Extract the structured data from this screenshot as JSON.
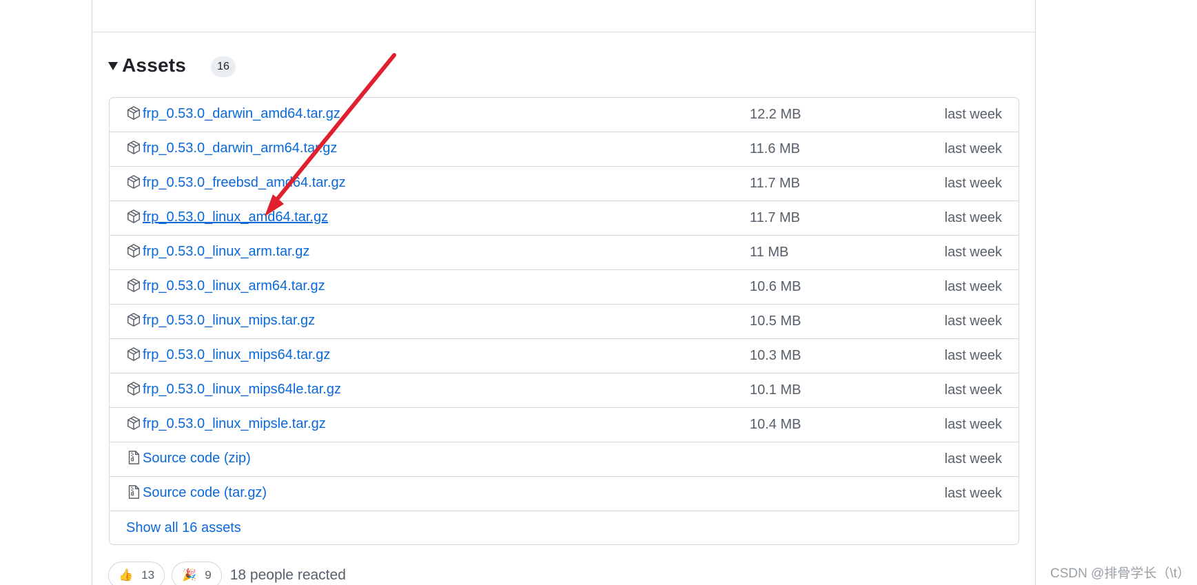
{
  "assets": {
    "title": "Assets",
    "count": "16",
    "items": [
      {
        "name": "frp_0.53.0_darwin_amd64.tar.gz",
        "size": "12.2 MB",
        "date": "last week",
        "icon": "package-icon"
      },
      {
        "name": "frp_0.53.0_darwin_arm64.tar.gz",
        "size": "11.6 MB",
        "date": "last week",
        "icon": "package-icon"
      },
      {
        "name": "frp_0.53.0_freebsd_amd64.tar.gz",
        "size": "11.7 MB",
        "date": "last week",
        "icon": "package-icon"
      },
      {
        "name": "frp_0.53.0_linux_amd64.tar.gz",
        "size": "11.7 MB",
        "date": "last week",
        "icon": "package-icon"
      },
      {
        "name": "frp_0.53.0_linux_arm.tar.gz",
        "size": "11 MB",
        "date": "last week",
        "icon": "package-icon"
      },
      {
        "name": "frp_0.53.0_linux_arm64.tar.gz",
        "size": "10.6 MB",
        "date": "last week",
        "icon": "package-icon"
      },
      {
        "name": "frp_0.53.0_linux_mips.tar.gz",
        "size": "10.5 MB",
        "date": "last week",
        "icon": "package-icon"
      },
      {
        "name": "frp_0.53.0_linux_mips64.tar.gz",
        "size": "10.3 MB",
        "date": "last week",
        "icon": "package-icon"
      },
      {
        "name": "frp_0.53.0_linux_mips64le.tar.gz",
        "size": "10.1 MB",
        "date": "last week",
        "icon": "package-icon"
      },
      {
        "name": "frp_0.53.0_linux_mipsle.tar.gz",
        "size": "10.4 MB",
        "date": "last week",
        "icon": "package-icon"
      }
    ],
    "source": [
      {
        "name": "Source code",
        "format": "(zip)",
        "date": "last week",
        "icon": "file-zip-icon"
      },
      {
        "name": "Source code",
        "format": "(tar.gz)",
        "date": "last week",
        "icon": "file-zip-icon"
      }
    ],
    "show_all": "Show all 16 assets"
  },
  "reactions": {
    "thumbs_up": {
      "emoji": "👍",
      "count": "13"
    },
    "hooray": {
      "emoji": "🎉",
      "count": "9"
    },
    "summary": "18 people reacted"
  },
  "watermark": "CSDN @排骨学长（\\t）",
  "colors": {
    "link": "#0969da",
    "muted": "#57606a",
    "border": "#d0d7de",
    "arrow": "#e0202e"
  }
}
